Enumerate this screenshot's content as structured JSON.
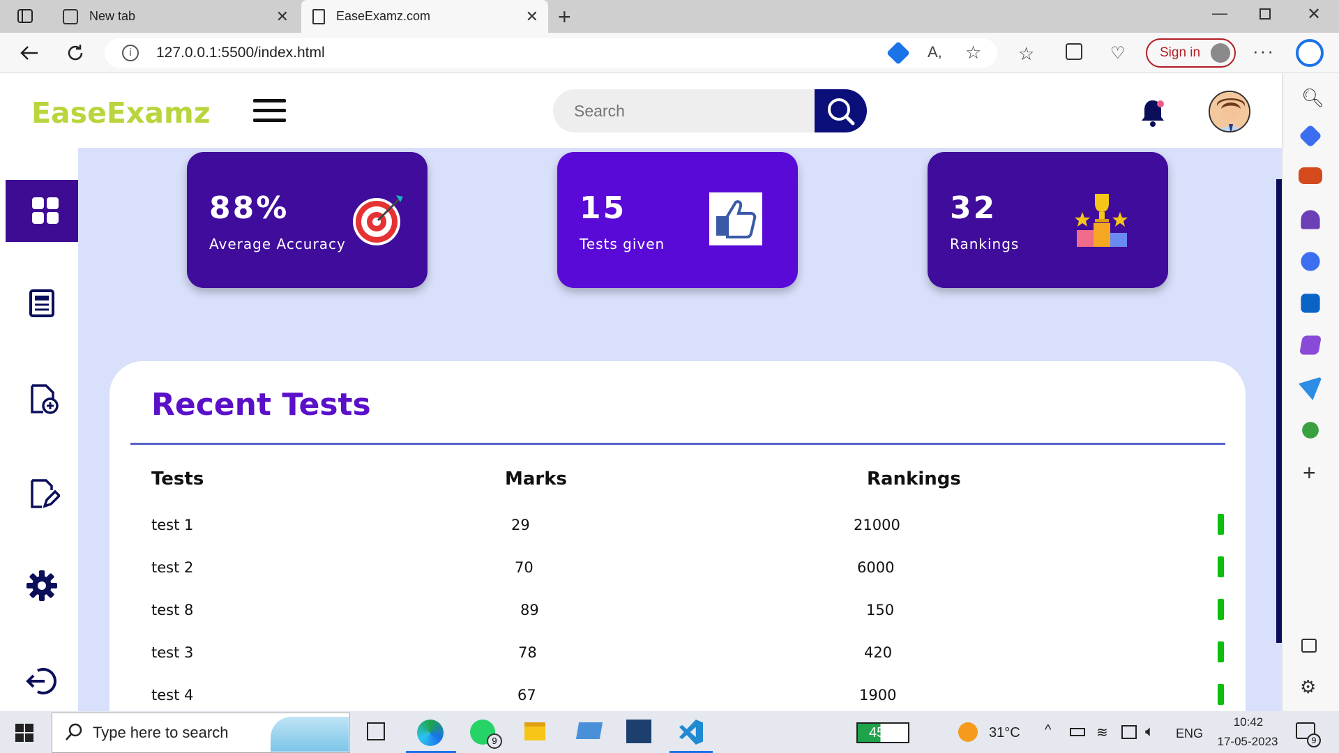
{
  "browser": {
    "tabs": [
      {
        "title": "New tab"
      },
      {
        "title": "EaseExamz.com"
      }
    ],
    "url": "127.0.0.1:5500/index.html",
    "sign_in": "Sign in"
  },
  "app": {
    "brand": "EaseExamz",
    "search": {
      "placeholder": "Search"
    },
    "stats": [
      {
        "value": "88%",
        "label": "Average Accuracy",
        "icon": "target-icon",
        "color": "#3f0c9b"
      },
      {
        "value": "15",
        "label": "Tests given",
        "icon": "thumbs-up-icon",
        "color": "#5a0ad6"
      },
      {
        "value": "32",
        "label": "Rankings",
        "icon": "trophy-podium-icon",
        "color": "#3f0c9b"
      }
    ],
    "recent": {
      "title": "Recent Tests",
      "columns": [
        "Tests",
        "Marks",
        "Rankings"
      ],
      "rows": [
        {
          "test": "test 1",
          "marks": "29",
          "ranking": "21000"
        },
        {
          "test": "test 2",
          "marks": "70",
          "ranking": "6000"
        },
        {
          "test": "test 8",
          "marks": "89",
          "ranking": "150"
        },
        {
          "test": "test 3",
          "marks": "78",
          "ranking": "420"
        },
        {
          "test": "test 4",
          "marks": "67",
          "ranking": "1900"
        }
      ]
    },
    "nav": [
      "dashboard-icon",
      "newspaper-icon",
      "add-file-icon",
      "edit-file-icon",
      "gear-icon",
      "logout-icon"
    ]
  },
  "taskbar": {
    "search_placeholder": "Type here to search",
    "battery": "45%",
    "weather": "31°C",
    "language": "ENG",
    "time": "10:42",
    "date": "17-05-2023",
    "whatsapp_badge": "9",
    "notification_badge": "9"
  },
  "colors": {
    "accent": "#3e0b93",
    "brand": "#b8d63c",
    "title": "#5a0fc8",
    "status": "#0bbf0b"
  }
}
